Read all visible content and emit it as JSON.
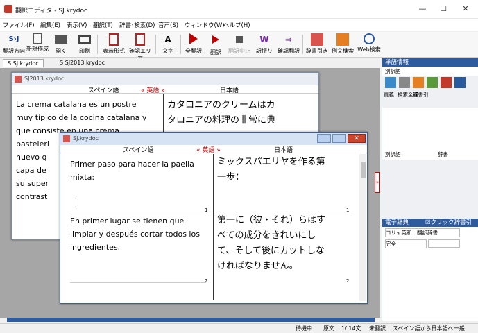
{
  "app": {
    "title": "翻訳エディタ - SJ.krydoc"
  },
  "window_controls": {
    "min": "—",
    "max": "☐",
    "close": "✕"
  },
  "menu": [
    "ファイル(F)",
    "編集(E)",
    "表示(V)",
    "翻訳(T)",
    "辞書･検索(D)",
    "音声(S)",
    "ウィンドウ(W)",
    "ヘルプ(H)"
  ],
  "toolbar": {
    "items": [
      "翻訳方向",
      "新規作成",
      "開く",
      "印刷",
      "表示形式",
      "確認エリア",
      "文字",
      "全翻訳",
      "翻訳",
      "翻訳中止",
      "訳振り",
      "確認翻訳",
      "辞書引き",
      "例文検索",
      "Web検索"
    ],
    "direction_icon": "S›J"
  },
  "tabs": [
    "S SJ.krydoc",
    "S SJ2013.krydoc"
  ],
  "back_window": {
    "title": "SJ2013.krydoc",
    "col_es": "スペイン語",
    "col_en": "« 英語 »",
    "col_ja": "日本語",
    "es_text": [
      "La crema catalana es un postre",
      "muy típico de la cocina catalana y",
      "que consiste en una crema",
      "pasteleri",
      "huevo q",
      "capa de",
      "su super",
      "contrast"
    ],
    "ja_text": [
      "カタロニアのクリームはカ",
      "タロニアの料理の非常に典"
    ]
  },
  "front_window": {
    "title": "SJ.krydoc",
    "col_es": "スペイン語",
    "col_en": "« 英語 »",
    "col_ja": "日本語",
    "row1_es": [
      "Primer paso para hacer la paella",
      "mixta:"
    ],
    "row1_ja": [
      "ミックスパエリヤを作る第",
      "一歩："
    ],
    "row1_num": "1",
    "row2_es": [
      "En primer lugar se tienen que",
      "limpiar y después cortar todos los",
      "ingredientes."
    ],
    "row2_ja": [
      "第一に（彼・それ）らはす",
      "べての成分をきれいにし",
      "て、そして後にカットしな",
      "ければなりません。"
    ],
    "row2_num": "2"
  },
  "right_panel": {
    "header": "単語情報",
    "tab": "別訳語",
    "icon_labels": [
      "責義",
      "検索全画",
      "辞書引",
      "辞書登録",
      "訳出禁止",
      "訳出通常"
    ],
    "col_alt": "別訳語",
    "col_dict": "辞書",
    "dict_header": "電子辞典",
    "click_lookup": "☑クリック辞書引",
    "dict_select": "コリャ英和！翻訳辞書",
    "mode_select": "完全"
  },
  "status": {
    "items": [
      "待機中",
      "原文",
      "1/ 14文",
      "未翻訳",
      "スペイン語から日本語へ",
      "一般"
    ]
  },
  "colors": {
    "accent": "#2d5b9e",
    "play": "#c00000"
  }
}
